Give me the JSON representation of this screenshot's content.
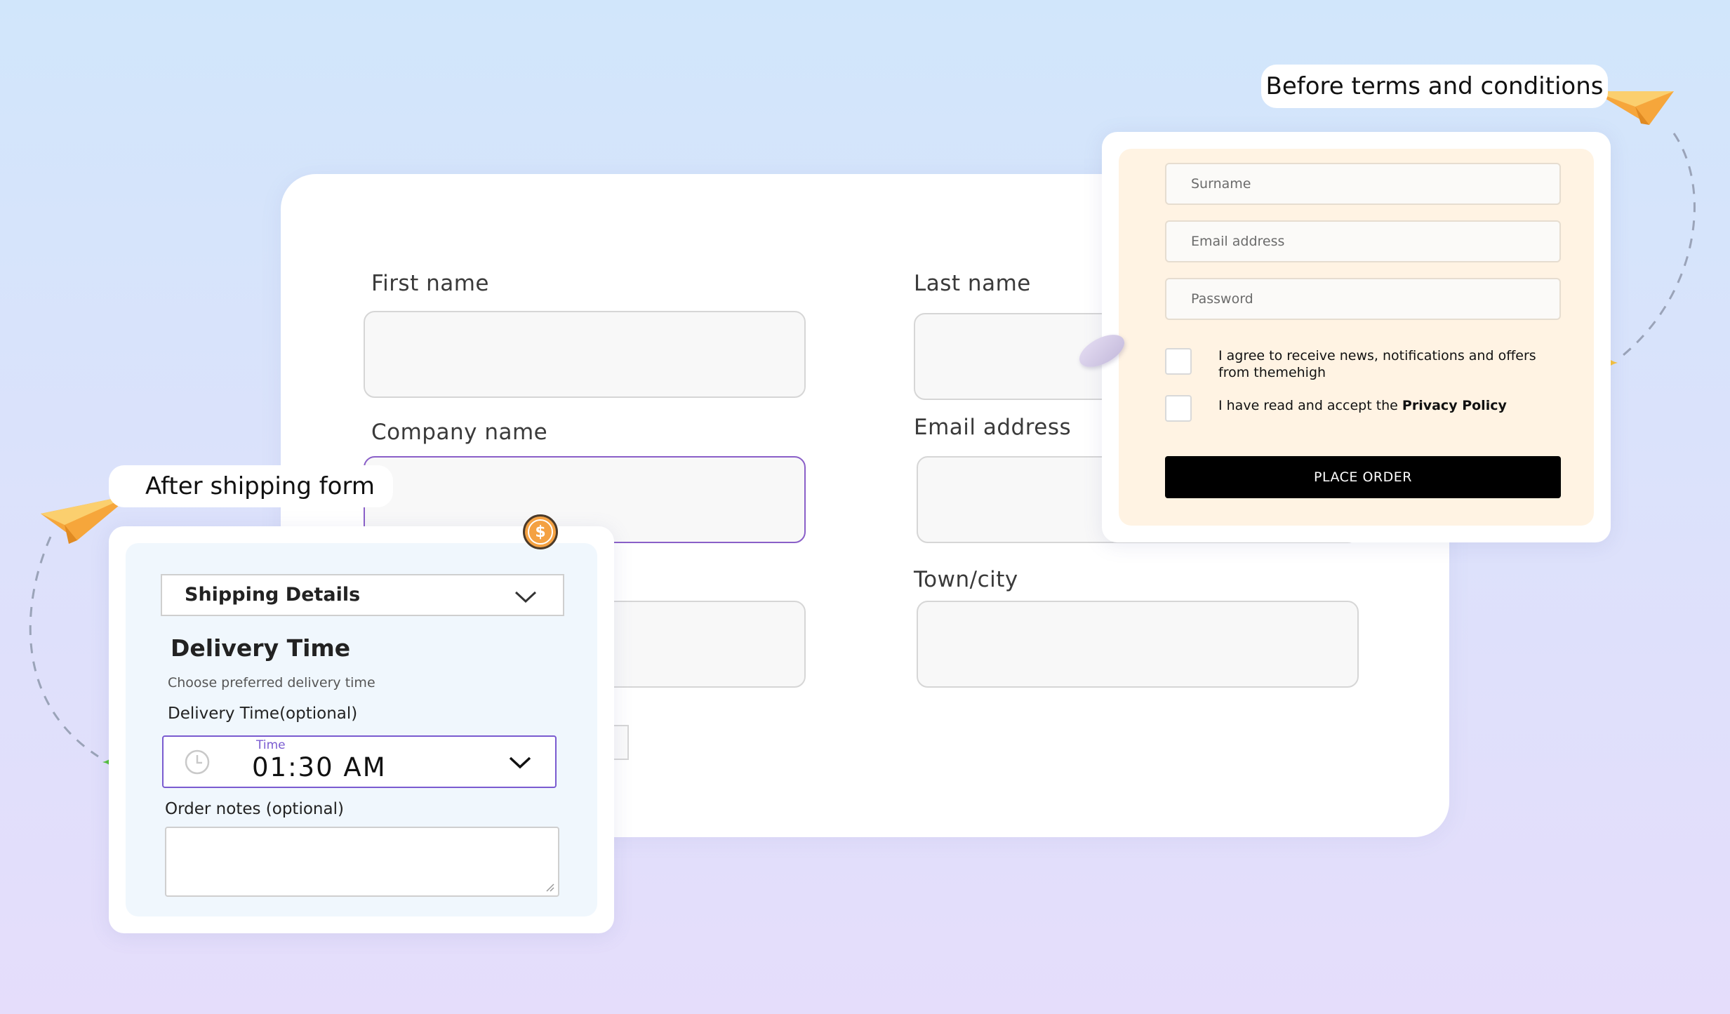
{
  "main_form": {
    "first_name_label": "First name",
    "last_name_label": "Last name",
    "company_name_label": "Company name",
    "email_label": "Email address",
    "town_label": "Town/city"
  },
  "after_shipping": {
    "callout": "After shipping form",
    "section_title": "Shipping Details",
    "delivery_heading": "Delivery Time",
    "delivery_subtitle": "Choose preferred delivery time",
    "delivery_label": "Delivery Time(optional)",
    "time_caption": "Time",
    "time_value": "01:30 AM",
    "notes_label": "Order notes (optional)"
  },
  "before_terms": {
    "callout": "Before terms and conditions",
    "surname_placeholder": "Surname",
    "email_placeholder": "Email address",
    "password_placeholder": "Password",
    "agree_news": "I agree to receive news, notifications and offers from themehigh",
    "agree_privacy_prefix": "I have read and accept the ",
    "agree_privacy_link": "Privacy Policy",
    "place_order": "PLACE ORDER"
  },
  "colors": {
    "accent_purple": "#7a5bd0",
    "button_black": "#000000",
    "coin_orange": "#f4a142",
    "star_green": "#53c13a",
    "star_yellow": "#f7c23b"
  },
  "icons": [
    "paper-plane-icon",
    "coin-icon",
    "sparkle-icon",
    "clock-icon",
    "chevron-down-icon",
    "resize-handle-icon"
  ]
}
